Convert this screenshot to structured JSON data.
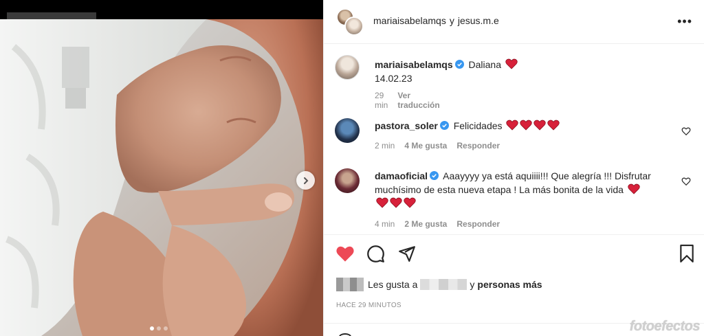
{
  "post": {
    "users": {
      "first": "mariaisabelamqs",
      "conjunction": "y",
      "second": "jesus.m.e"
    },
    "more_icon": "more-horizontal-icon",
    "photo_dots": {
      "count": 3,
      "active": 1
    }
  },
  "caption": {
    "user": "mariaisabelamqs",
    "text": "Daliana",
    "date_line": "14.02.23",
    "time": "29 min",
    "translate": "Ver traducción"
  },
  "comments": [
    {
      "user": "pastora_soler",
      "text": "Felicidades",
      "hearts": 4,
      "time": "2 min",
      "likes": "4 Me gusta",
      "reply": "Responder"
    },
    {
      "user": "damaoficial",
      "text": "Aaayyyy ya está aquiiii!!! Que alegría !!! Disfrutar muchísimo de esta nueva etapa ! La más bonita de la vida",
      "hearts": 4,
      "time": "4 min",
      "likes": "2 Me gusta",
      "reply": "Responder"
    }
  ],
  "likes": {
    "prefix": "Les gusta a",
    "conjunction": "y",
    "rest": "personas más"
  },
  "timestamp": "HACE 29 MINUTOS",
  "watermark": "fotoefectos",
  "colors": {
    "like_red": "#ed4956",
    "verified_blue": "#3897f0",
    "meta_gray": "#8e8e8e"
  }
}
